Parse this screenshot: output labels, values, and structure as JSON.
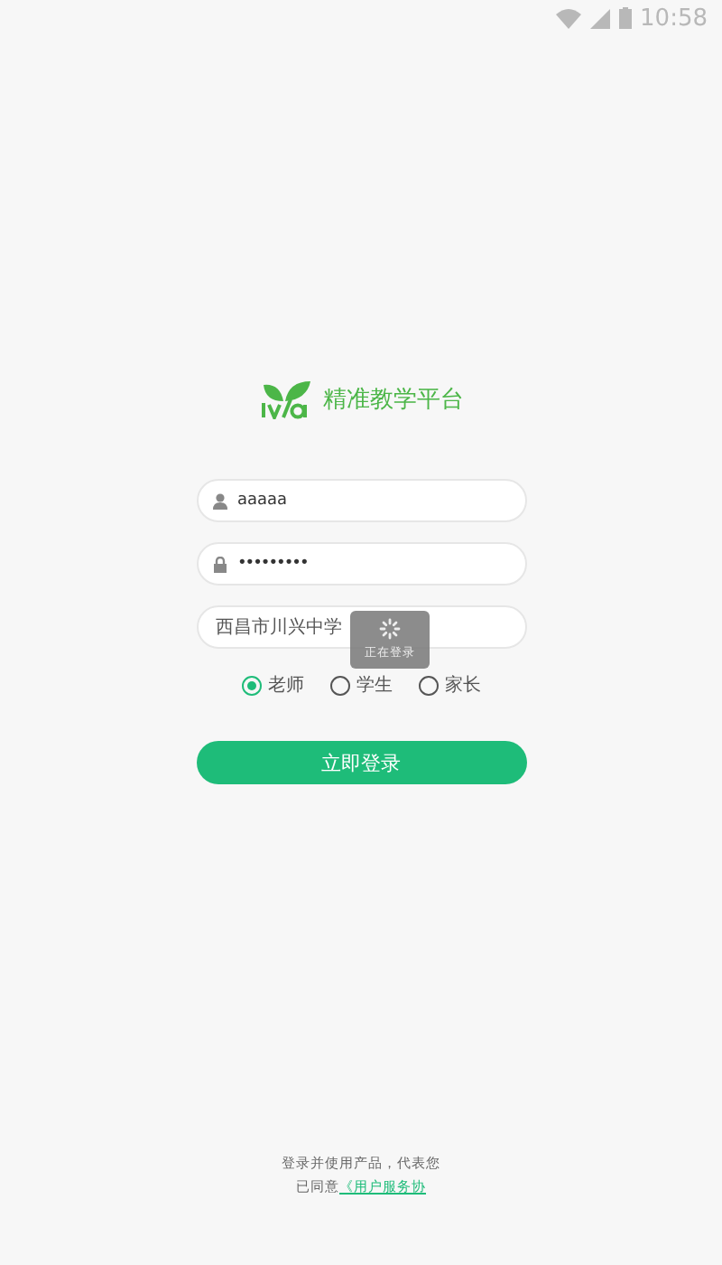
{
  "status_bar": {
    "time": "10:58"
  },
  "app": {
    "title": "精准教学平台"
  },
  "form": {
    "username": "aaaaa",
    "password": "•••••••••",
    "school": "西昌市川兴中学"
  },
  "roles": [
    {
      "label": "老师",
      "selected": true
    },
    {
      "label": "学生",
      "selected": false
    },
    {
      "label": "家长",
      "selected": false
    }
  ],
  "login_button": "立即登录",
  "toast": {
    "text": "正在登录"
  },
  "footer": {
    "line1": "登录并使用产品，代表您",
    "agree": "已同意",
    "link": "《用户服务协"
  }
}
